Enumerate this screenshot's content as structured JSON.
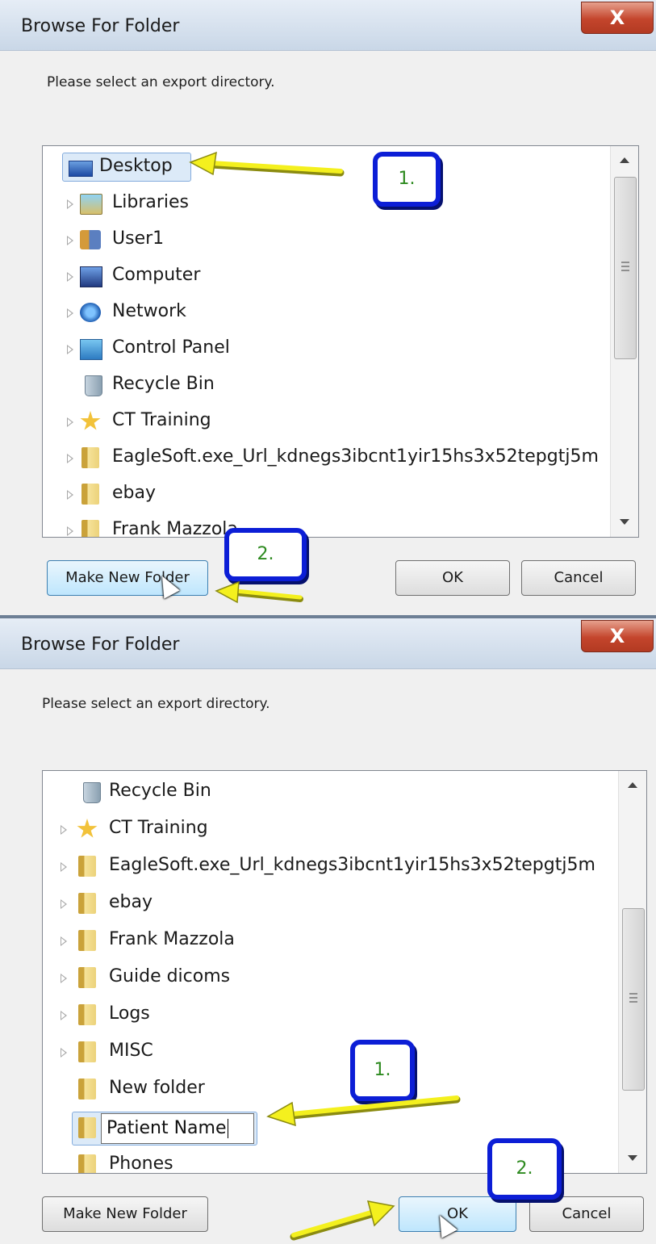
{
  "dialog_top": {
    "title": "Browse For Folder",
    "close_glyph": "X",
    "prompt": "Please select an export directory.",
    "tree_items": [
      {
        "label": "Desktop",
        "icon": "desktop-icon"
      },
      {
        "label": "Libraries",
        "icon": "libraries-icon"
      },
      {
        "label": "User1",
        "icon": "user-icon"
      },
      {
        "label": "Computer",
        "icon": "computer-icon"
      },
      {
        "label": "Network",
        "icon": "network-icon"
      },
      {
        "label": "Control Panel",
        "icon": "control-panel-icon"
      },
      {
        "label": "Recycle Bin",
        "icon": "recycle-bin-icon"
      },
      {
        "label": "CT Training",
        "icon": "star-icon"
      },
      {
        "label": "EagleSoft.exe_Url_kdnegs3ibcnt1yir15hs3x52tepgtj5m",
        "icon": "folder-icon"
      },
      {
        "label": "ebay",
        "icon": "folder-icon"
      },
      {
        "label": "Frank Mazzola",
        "icon": "folder-icon"
      }
    ],
    "buttons": {
      "make_new_folder": "Make New Folder",
      "ok": "OK",
      "cancel": "Cancel"
    },
    "callouts": {
      "step1": "1.",
      "step2": "2."
    }
  },
  "dialog_bottom": {
    "title": "Browse For Folder",
    "close_glyph": "X",
    "prompt": "Please select an export directory.",
    "tree_items": [
      {
        "label": "Recycle Bin",
        "icon": "recycle-bin-icon"
      },
      {
        "label": "CT Training",
        "icon": "star-icon"
      },
      {
        "label": "EagleSoft.exe_Url_kdnegs3ibcnt1yir15hs3x52tepgtj5m",
        "icon": "folder-icon"
      },
      {
        "label": "ebay",
        "icon": "folder-icon"
      },
      {
        "label": "Frank Mazzola",
        "icon": "folder-icon"
      },
      {
        "label": "Guide dicoms",
        "icon": "folder-icon"
      },
      {
        "label": "Logs",
        "icon": "folder-icon"
      },
      {
        "label": "MISC",
        "icon": "folder-icon"
      },
      {
        "label": "New folder",
        "icon": "folder-icon"
      },
      {
        "label": "Patient Name",
        "icon": "folder-icon"
      },
      {
        "label": "Phones",
        "icon": "folder-icon"
      }
    ],
    "rename_value": "Patient Name",
    "buttons": {
      "make_new_folder": "Make New Folder",
      "ok": "OK",
      "cancel": "Cancel"
    },
    "callouts": {
      "step1": "1.",
      "step2": "2."
    }
  },
  "colors": {
    "callout_border": "#0c1ed6",
    "callout_text": "#2d8a1f",
    "arrow": "#f4f01e",
    "selection": "#dceaf8"
  }
}
